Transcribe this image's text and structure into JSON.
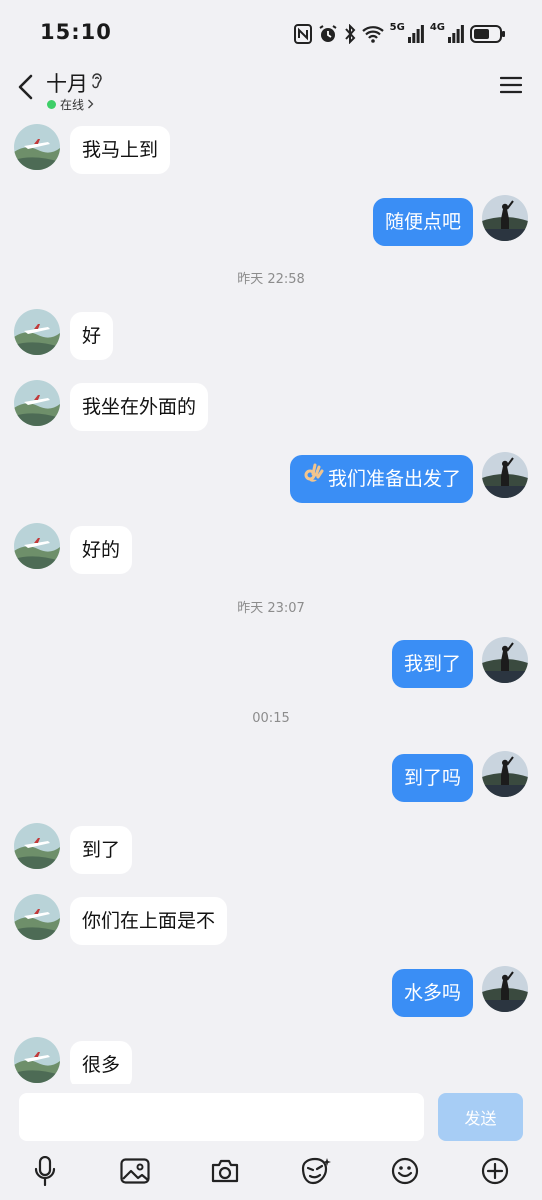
{
  "status_bar": {
    "time": "15:10",
    "network_5g": "5G",
    "network_4g": "4G",
    "icons": [
      "nfc-icon",
      "alarm-icon",
      "bluetooth-icon",
      "wifi-icon",
      "signal-icon",
      "battery-icon"
    ]
  },
  "header": {
    "contact_name": "十月",
    "presence": "在线",
    "icons": [
      "back-icon",
      "ear-icon",
      "menu-icon"
    ]
  },
  "colors": {
    "background": "#f1f1f4",
    "outgoing_bubble": "#3a8ef5",
    "incoming_bubble": "#ffffff",
    "online": "#3ecf68",
    "send_button": "#a7cdf5"
  },
  "messages": [
    {
      "dir": "in",
      "text": "我马上到"
    },
    {
      "dir": "out",
      "text": "随便点吧"
    },
    {
      "type": "time",
      "text": "昨天 22:58"
    },
    {
      "dir": "in",
      "text": "好"
    },
    {
      "dir": "in",
      "text": "我坐在外面的"
    },
    {
      "dir": "out",
      "text": "我们准备出发了",
      "emoji": "ok-hand-emoji"
    },
    {
      "dir": "in",
      "text": "好的"
    },
    {
      "type": "time",
      "text": "昨天 23:07"
    },
    {
      "dir": "out",
      "text": "我到了"
    },
    {
      "type": "time",
      "text": "00:15"
    },
    {
      "dir": "out",
      "text": "到了吗"
    },
    {
      "dir": "in",
      "text": "到了"
    },
    {
      "dir": "in",
      "text": "你们在上面是不"
    },
    {
      "dir": "out",
      "text": "水多吗"
    },
    {
      "dir": "in",
      "text": "很多"
    }
  ],
  "input": {
    "value": "",
    "send_label": "发送"
  },
  "toolbar": {
    "icons": [
      "microphone-icon",
      "image-icon",
      "camera-icon",
      "sticker-icon",
      "emoji-icon",
      "plus-icon"
    ]
  }
}
